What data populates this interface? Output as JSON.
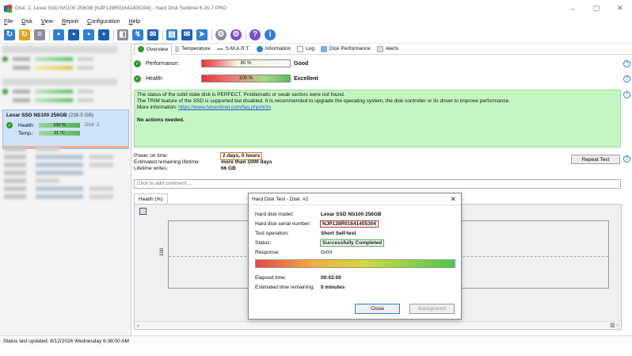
{
  "window": {
    "title": "Disk: 2, Lexar SSD NS100 256GB [NJP128R01641405304] - Hard Disk Sentinel 6.20.7 PRO",
    "minimize": "–",
    "maximize": "▢",
    "close": "✕"
  },
  "menu": [
    "File",
    "Disk",
    "View",
    "Report",
    "Configuration",
    "Help"
  ],
  "tabs": [
    {
      "label": "Overview",
      "icon": "check-icon"
    },
    {
      "label": "Temperature",
      "icon": "thermometer-icon"
    },
    {
      "label": "S.M.A.R.T.",
      "icon": "smart-icon"
    },
    {
      "label": "Information",
      "icon": "info-icon"
    },
    {
      "label": "Log",
      "icon": "log-icon"
    },
    {
      "label": "Disk Performance",
      "icon": "performance-icon"
    },
    {
      "label": "Alerts",
      "icon": "alert-icon"
    }
  ],
  "selected_disk": {
    "title": "Lexar SSD NS100 256GB",
    "size": "(238.5 GB)",
    "health_label": "Health:",
    "health_value": "100 %",
    "disk_label": "Disk: 2",
    "temp_label": "Temp.:",
    "temp_value": "31 °C"
  },
  "overview": {
    "performance_label": "Performance:",
    "performance_value": "80 %",
    "performance_word": "Good",
    "health_label": "Health:",
    "health_value": "100 %",
    "health_word": "Excellent",
    "status_lines": [
      "The status of the solid state disk is PERFECT. Problematic or weak sectors were not found.",
      "The TRIM feature of the SSD is supported but disabled. It is recommended to upgrade the operating system, the disk controller or its driver to improve performance.",
      "More information: "
    ],
    "status_link": "https://www.hdsentinel.com/faq.php#trim",
    "no_actions": "No actions needed.",
    "power_on_label": "Power on time:",
    "power_on_value": "2 days, 0 hours",
    "remaining_label": "Estimated remaining lifetime:",
    "remaining_value": "more than 1000 days",
    "writes_label": "Lifetime writes:",
    "writes_value": "66 GB",
    "repeat_test": "Repeat Test",
    "comment_placeholder": "Click to add comment ..."
  },
  "graph": {
    "tab": "Health (%)",
    "y_label": "100"
  },
  "dialog": {
    "title": "Hard Disk Test - Disk: #2",
    "model_label": "Hard disk model:",
    "model_value": "Lexar SSD NS100 256GB",
    "serial_label": "Hard disk serial number:",
    "serial_value": "NJP128R01641405304",
    "operation_label": "Test operation:",
    "operation_value": "Short Self-test",
    "status_label": "Status:",
    "status_value": "Successfully Completed",
    "response_label": "Response:",
    "response_value": "0x00",
    "progress": 1.0,
    "elapsed_label": "Elapsed time:",
    "elapsed_value": "00:02:00",
    "remaining_label": "Estimated time remaining:",
    "remaining_value": "0 minutes",
    "close_button": "Close",
    "background_button": "Background"
  },
  "statusbar": "Status last updated: 8/12/2026 Wednesday 6:38:00 AM",
  "colors": {
    "status_box": "#c4f6c4",
    "selected_disk": "#cfe3fb",
    "highlight_orange": "#e07820",
    "highlight_red": "#d23030",
    "highlight_green": "#46b046"
  }
}
